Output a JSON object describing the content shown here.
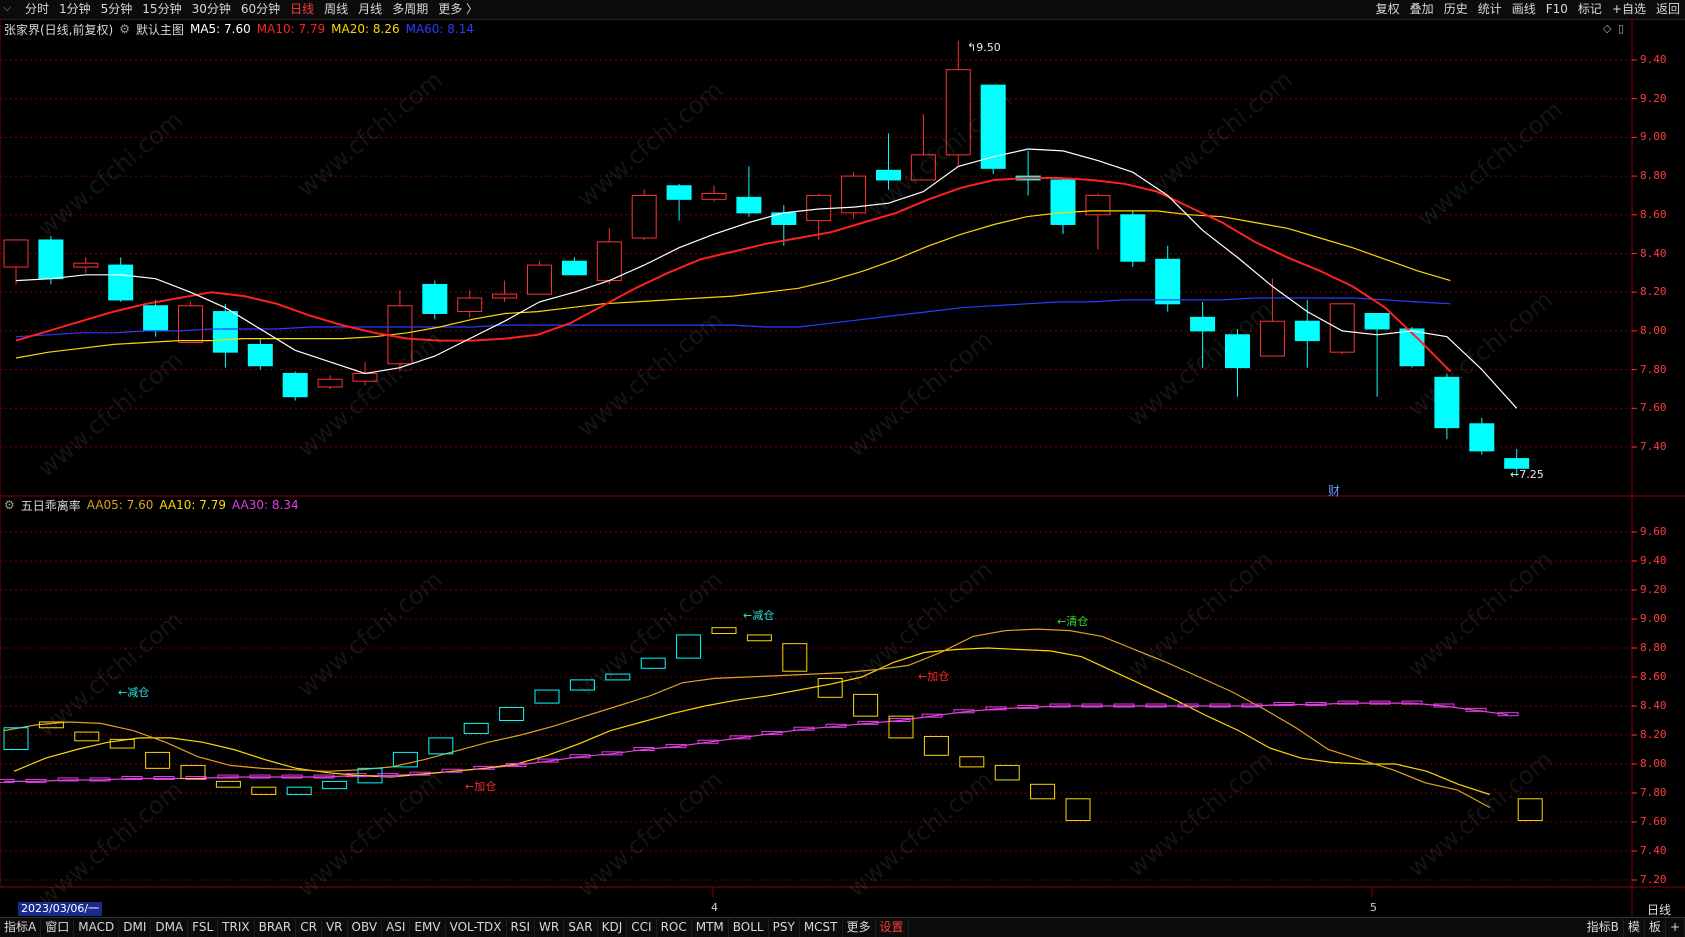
{
  "toolbar": {
    "period_tabs": [
      {
        "label": "分时",
        "active": false
      },
      {
        "label": "1分钟",
        "active": false
      },
      {
        "label": "5分钟",
        "active": false
      },
      {
        "label": "15分钟",
        "active": false
      },
      {
        "label": "30分钟",
        "active": false
      },
      {
        "label": "60分钟",
        "active": false
      },
      {
        "label": "日线",
        "active": true
      },
      {
        "label": "周线",
        "active": false
      },
      {
        "label": "月线",
        "active": false
      },
      {
        "label": "多周期",
        "active": false
      },
      {
        "label": "更多 〉",
        "active": false
      }
    ],
    "right_tools": [
      "复权",
      "叠加",
      "历史",
      "统计",
      "画线",
      "F10",
      "标记",
      "+自选",
      "返回"
    ]
  },
  "main_panel": {
    "stock_title": "张家界(日线,前复权)",
    "template": "默认主图",
    "indicators": [
      {
        "label": "MA5: 7.60",
        "color": "#ffffff"
      },
      {
        "label": "MA10: 7.79",
        "color": "#ff2020"
      },
      {
        "label": "MA20: 8.26",
        "color": "#ffd700"
      },
      {
        "label": "MA60: 8.14",
        "color": "#2b3bff"
      }
    ],
    "high_marker": "9.50",
    "low_marker": "7.25",
    "fin_marker": "财",
    "y_axis_labels": [
      "9.40",
      "9.20",
      "9.00",
      "8.80",
      "8.60",
      "8.40",
      "8.20",
      "8.00",
      "7.80",
      "7.60",
      "7.40"
    ]
  },
  "sub_panel": {
    "indicator_name": "五日乖离率",
    "indicators": [
      {
        "label": "AA05: 7.60",
        "color": "#e0a020"
      },
      {
        "label": "AA10: 7.79",
        "color": "#ffd700"
      },
      {
        "label": "AA30: 8.34",
        "color": "#e040e0"
      }
    ],
    "signals": [
      {
        "text": "←减仓",
        "color": "#30e0e0"
      },
      {
        "text": "←减仓",
        "color": "#30e0e0"
      },
      {
        "text": "←加仓",
        "color": "#ff3030"
      },
      {
        "text": "←加仓",
        "color": "#ff3030"
      },
      {
        "text": "←清仓",
        "color": "#30e030"
      }
    ],
    "y_axis_labels": [
      "9.60",
      "9.40",
      "9.20",
      "9.00",
      "8.80",
      "8.60",
      "8.40",
      "8.20",
      "8.00",
      "7.80",
      "7.60",
      "7.40",
      "7.20"
    ]
  },
  "date_axis": {
    "start_date": "2023/03/06/一",
    "month_markers": [
      "4",
      "5"
    ],
    "period_label": "日线"
  },
  "bottom_bar": {
    "tabs": [
      "指标A",
      "窗口",
      "MACD",
      "DMI",
      "DMA",
      "FSL",
      "TRIX",
      "BRAR",
      "CR",
      "VR",
      "OBV",
      "ASI",
      "EMV",
      "VOL-TDX",
      "RSI",
      "WR",
      "SAR",
      "KDJ",
      "CCI",
      "ROC",
      "MTM",
      "BOLL",
      "PSY",
      "MCST",
      "更多",
      "设置"
    ],
    "right_items": [
      "指标B",
      "模",
      "板",
      "+"
    ]
  },
  "watermark_text": "www.cfchi.com",
  "colors": {
    "up": "#ff3030",
    "down": "#00ffff",
    "ma5": "#ffffff",
    "ma10": "#ff2020",
    "ma20": "#ffd700",
    "ma60": "#2b3bff",
    "aa05": "#e0a020",
    "aa10": "#ffd700",
    "aa30": "#e040e0",
    "grid": "#7a0000"
  },
  "chart_data": {
    "type": "candlestick",
    "candles": [
      {
        "o": 8.33,
        "c": 8.47,
        "h": 8.47,
        "l": 8.24
      },
      {
        "o": 8.47,
        "c": 8.27,
        "h": 8.49,
        "l": 8.24
      },
      {
        "o": 8.33,
        "c": 8.35,
        "h": 8.38,
        "l": 8.3
      },
      {
        "o": 8.34,
        "c": 8.16,
        "h": 8.38,
        "l": 8.15
      },
      {
        "o": 8.13,
        "c": 8.0,
        "h": 8.16,
        "l": 7.97
      },
      {
        "o": 7.94,
        "c": 8.13,
        "h": 8.15,
        "l": 7.94
      },
      {
        "o": 8.1,
        "c": 7.89,
        "h": 8.14,
        "l": 7.81
      },
      {
        "o": 7.93,
        "c": 7.82,
        "h": 7.96,
        "l": 7.8
      },
      {
        "o": 7.78,
        "c": 7.66,
        "h": 7.79,
        "l": 7.64
      },
      {
        "o": 7.71,
        "c": 7.75,
        "h": 7.77,
        "l": 7.7
      },
      {
        "o": 7.74,
        "c": 7.78,
        "h": 7.84,
        "l": 7.72
      },
      {
        "o": 7.83,
        "c": 8.13,
        "h": 8.21,
        "l": 7.79
      },
      {
        "o": 8.24,
        "c": 8.09,
        "h": 8.26,
        "l": 8.06
      },
      {
        "o": 8.1,
        "c": 8.17,
        "h": 8.21,
        "l": 8.07
      },
      {
        "o": 8.17,
        "c": 8.19,
        "h": 8.26,
        "l": 8.15
      },
      {
        "o": 8.19,
        "c": 8.34,
        "h": 8.36,
        "l": 8.19
      },
      {
        "o": 8.36,
        "c": 8.29,
        "h": 8.38,
        "l": 8.29
      },
      {
        "o": 8.26,
        "c": 8.46,
        "h": 8.53,
        "l": 8.24
      },
      {
        "o": 8.48,
        "c": 8.7,
        "h": 8.73,
        "l": 8.47
      },
      {
        "o": 8.75,
        "c": 8.68,
        "h": 8.76,
        "l": 8.57
      },
      {
        "o": 8.68,
        "c": 8.71,
        "h": 8.75,
        "l": 8.67
      },
      {
        "o": 8.69,
        "c": 8.61,
        "h": 8.85,
        "l": 8.59
      },
      {
        "o": 8.61,
        "c": 8.55,
        "h": 8.65,
        "l": 8.44
      },
      {
        "o": 8.57,
        "c": 8.7,
        "h": 8.71,
        "l": 8.47
      },
      {
        "o": 8.61,
        "c": 8.8,
        "h": 8.82,
        "l": 8.58
      },
      {
        "o": 8.83,
        "c": 8.78,
        "h": 9.02,
        "l": 8.73
      },
      {
        "o": 8.78,
        "c": 8.91,
        "h": 9.12,
        "l": 8.78
      },
      {
        "o": 8.91,
        "c": 9.35,
        "h": 9.5,
        "l": 8.85
      },
      {
        "o": 9.27,
        "c": 8.84,
        "h": 9.27,
        "l": 8.81
      },
      {
        "o": 8.8,
        "c": 8.78,
        "h": 8.93,
        "l": 8.7
      },
      {
        "o": 8.78,
        "c": 8.55,
        "h": 8.79,
        "l": 8.5
      },
      {
        "o": 8.6,
        "c": 8.7,
        "h": 8.71,
        "l": 8.42
      },
      {
        "o": 8.6,
        "c": 8.36,
        "h": 8.62,
        "l": 8.33
      },
      {
        "o": 8.37,
        "c": 8.14,
        "h": 8.44,
        "l": 8.1
      },
      {
        "o": 8.07,
        "c": 8.0,
        "h": 8.15,
        "l": 7.81
      },
      {
        "o": 7.98,
        "c": 7.81,
        "h": 8.01,
        "l": 7.66
      },
      {
        "o": 7.87,
        "c": 8.05,
        "h": 8.27,
        "l": 7.87
      },
      {
        "o": 8.05,
        "c": 7.95,
        "h": 8.16,
        "l": 7.81
      },
      {
        "o": 7.89,
        "c": 8.14,
        "h": 8.14,
        "l": 7.88
      },
      {
        "o": 8.09,
        "c": 8.01,
        "h": 8.09,
        "l": 7.66
      },
      {
        "o": 8.01,
        "c": 7.82,
        "h": 8.02,
        "l": 7.81
      },
      {
        "o": 7.76,
        "c": 7.5,
        "h": 7.78,
        "l": 7.44
      },
      {
        "o": 7.52,
        "c": 7.38,
        "h": 7.55,
        "l": 7.36
      },
      {
        "o": 7.34,
        "c": 7.29,
        "h": 7.39,
        "l": 7.25
      }
    ],
    "ma5": [
      8.26,
      8.27,
      8.29,
      8.29,
      8.27,
      8.2,
      8.12,
      8.01,
      7.9,
      7.84,
      7.78,
      7.81,
      7.87,
      7.96,
      8.05,
      8.15,
      8.2,
      8.26,
      8.34,
      8.43,
      8.5,
      8.56,
      8.61,
      8.63,
      8.64,
      8.66,
      8.72,
      8.85,
      8.9,
      8.94,
      8.93,
      8.88,
      8.82,
      8.7,
      8.52,
      8.38,
      8.23,
      8.1,
      8.0,
      7.98,
      8.0,
      7.97,
      7.8,
      7.6
    ],
    "ma10": [
      7.95,
      8.0,
      8.05,
      8.1,
      8.14,
      8.17,
      8.2,
      8.18,
      8.14,
      8.08,
      8.03,
      7.99,
      7.96,
      7.95,
      7.95,
      7.96,
      7.98,
      8.04,
      8.13,
      8.22,
      8.3,
      8.37,
      8.41,
      8.45,
      8.48,
      8.51,
      8.56,
      8.61,
      8.68,
      8.74,
      8.78,
      8.79,
      8.79,
      8.78,
      8.76,
      8.72,
      8.64,
      8.56,
      8.46,
      8.38,
      8.31,
      8.23,
      8.12,
      7.96,
      7.79
    ],
    "ma20": [
      7.86,
      7.89,
      7.91,
      7.93,
      7.94,
      7.95,
      7.95,
      7.96,
      7.96,
      7.96,
      7.96,
      7.97,
      7.99,
      8.02,
      8.06,
      8.09,
      8.1,
      8.12,
      8.14,
      8.15,
      8.16,
      8.17,
      8.18,
      8.2,
      8.22,
      8.26,
      8.31,
      8.37,
      8.44,
      8.5,
      8.55,
      8.59,
      8.61,
      8.62,
      8.62,
      8.62,
      8.6,
      8.59,
      8.56,
      8.53,
      8.48,
      8.43,
      8.37,
      8.31,
      8.26
    ],
    "ma60": [
      7.97,
      7.98,
      7.99,
      7.99,
      8.0,
      8.0,
      8.01,
      8.01,
      8.01,
      8.02,
      8.02,
      8.02,
      8.02,
      8.02,
      8.02,
      8.03,
      8.03,
      8.03,
      8.03,
      8.03,
      8.03,
      8.03,
      8.03,
      8.02,
      8.02,
      8.04,
      8.06,
      8.08,
      8.1,
      8.12,
      8.13,
      8.14,
      8.15,
      8.15,
      8.16,
      8.16,
      8.16,
      8.16,
      8.17,
      8.17,
      8.17,
      8.17,
      8.16,
      8.15,
      8.14
    ],
    "sub_boxes": [
      {
        "top": 8.25,
        "bot": 8.1,
        "color": "#00ffff"
      },
      {
        "top": 8.29,
        "bot": 8.25,
        "color": "#ffd700"
      },
      {
        "top": 8.22,
        "bot": 8.16,
        "color": "#ffd700"
      },
      {
        "top": 8.17,
        "bot": 8.11,
        "color": "#ffd700"
      },
      {
        "top": 8.08,
        "bot": 7.97,
        "color": "#ffd700"
      },
      {
        "top": 7.99,
        "bot": 7.9,
        "color": "#ffd700"
      },
      {
        "top": 7.88,
        "bot": 7.84,
        "color": "#ffd700"
      },
      {
        "top": 7.84,
        "bot": 7.79,
        "color": "#ffd700"
      },
      {
        "top": 7.84,
        "bot": 7.79,
        "color": "#00ffff"
      },
      {
        "top": 7.88,
        "bot": 7.83,
        "color": "#00ffff"
      },
      {
        "top": 7.97,
        "bot": 7.87,
        "color": "#00ffff"
      },
      {
        "top": 8.08,
        "bot": 7.98,
        "color": "#00ffff"
      },
      {
        "top": 8.18,
        "bot": 8.07,
        "color": "#00ffff"
      },
      {
        "top": 8.28,
        "bot": 8.21,
        "color": "#00ffff"
      },
      {
        "top": 8.39,
        "bot": 8.3,
        "color": "#00ffff"
      },
      {
        "top": 8.51,
        "bot": 8.42,
        "color": "#00ffff"
      },
      {
        "top": 8.58,
        "bot": 8.51,
        "color": "#00ffff"
      },
      {
        "top": 8.62,
        "bot": 8.58,
        "color": "#00ffff"
      },
      {
        "top": 8.73,
        "bot": 8.66,
        "color": "#00ffff"
      },
      {
        "top": 8.89,
        "bot": 8.73,
        "color": "#00ffff"
      },
      {
        "top": 8.94,
        "bot": 8.9,
        "color": "#ffd700"
      },
      {
        "top": 8.89,
        "bot": 8.85,
        "color": "#ffd700"
      },
      {
        "top": 8.83,
        "bot": 8.64,
        "color": "#ffd700"
      },
      {
        "top": 8.59,
        "bot": 8.46,
        "color": "#ffd700"
      },
      {
        "top": 8.48,
        "bot": 8.33,
        "color": "#ffd700"
      },
      {
        "top": 8.33,
        "bot": 8.18,
        "color": "#ffd700"
      },
      {
        "top": 8.19,
        "bot": 8.06,
        "color": "#ffd700"
      },
      {
        "top": 8.05,
        "bot": 7.98,
        "color": "#ffd700"
      },
      {
        "top": 7.99,
        "bot": 7.89,
        "color": "#ffd700"
      },
      {
        "top": 7.86,
        "bot": 7.76,
        "color": "#ffd700"
      },
      {
        "top": 7.76,
        "bot": 7.61,
        "color": "#ffd700"
      }
    ],
    "aa05": [
      8.23,
      8.27,
      8.29,
      8.28,
      8.23,
      8.15,
      8.05,
      7.99,
      7.97,
      7.96,
      7.95,
      7.96,
      7.98,
      8.03,
      8.09,
      8.15,
      8.2,
      8.26,
      8.33,
      8.4,
      8.47,
      8.56,
      8.59,
      8.6,
      8.61,
      8.62,
      8.63,
      8.65,
      8.68,
      8.77,
      8.88,
      8.92,
      8.93,
      8.92,
      8.88,
      8.79,
      8.7,
      8.6,
      8.5,
      8.38,
      8.25,
      8.1,
      8.03,
      7.96,
      7.87,
      7.82,
      7.7
    ],
    "aa10": [
      7.95,
      8.04,
      8.1,
      8.15,
      8.18,
      8.18,
      8.15,
      8.1,
      8.03,
      7.97,
      7.94,
      7.92,
      7.91,
      7.93,
      7.95,
      7.97,
      8.0,
      8.06,
      8.14,
      8.23,
      8.29,
      8.35,
      8.4,
      8.44,
      8.47,
      8.51,
      8.55,
      8.6,
      8.7,
      8.77,
      8.79,
      8.8,
      8.79,
      8.78,
      8.74,
      8.64,
      8.54,
      8.44,
      8.33,
      8.23,
      8.11,
      8.04,
      8.01,
      8.0,
      8.0,
      7.95,
      7.86,
      7.79
    ],
    "aa30": [
      7.88,
      7.88,
      7.89,
      7.89,
      7.9,
      7.9,
      7.9,
      7.91,
      7.91,
      7.91,
      7.91,
      7.92,
      7.92,
      7.93,
      7.95,
      7.97,
      7.99,
      8.02,
      8.05,
      8.07,
      8.1,
      8.12,
      8.15,
      8.18,
      8.21,
      8.24,
      8.26,
      8.28,
      8.3,
      8.33,
      8.36,
      8.38,
      8.39,
      8.4,
      8.4,
      8.4,
      8.4,
      8.4,
      8.4,
      8.4,
      8.41,
      8.41,
      8.42,
      8.42,
      8.42,
      8.4,
      8.37,
      8.34
    ]
  }
}
